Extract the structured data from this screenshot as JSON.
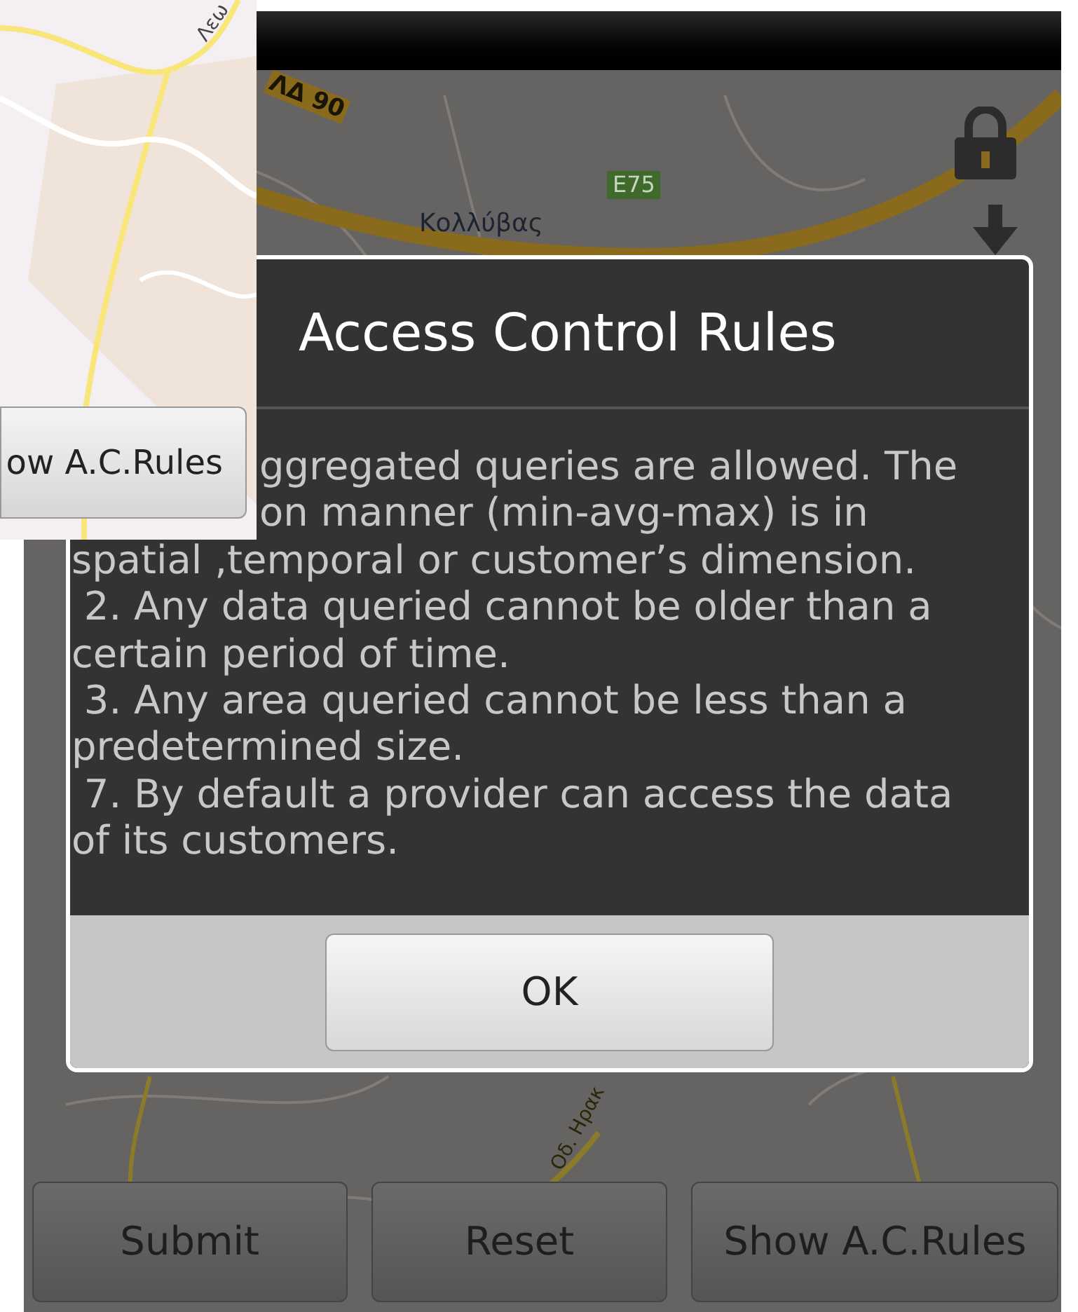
{
  "inset": {
    "map_label": "Λεω",
    "button": "ow A.C.Rules"
  },
  "map": {
    "labels": [
      {
        "kind": "road",
        "text": "ΛΔ 90"
      },
      {
        "kind": "shield",
        "text": "E75"
      },
      {
        "kind": "place",
        "text": "Κολλύβας"
      },
      {
        "kind": "street",
        "text": "Οδ. Ηρακ"
      }
    ]
  },
  "dialog": {
    "title": "Access Control Rules",
    "lines": [
      {
        "kind": "partial",
        "text": "ggregated queries are allowed. The"
      },
      {
        "kind": "partial",
        "text": "on manner (min-avg-max) is in"
      },
      {
        "kind": "full",
        "text": "spatial ,temporal or customer’s dimension."
      },
      {
        "kind": "full",
        "text": " 2. Any data queried cannot be older than a"
      },
      {
        "kind": "full",
        "text": "certain period of time."
      },
      {
        "kind": "full",
        "text": " 3. Any area queried cannot be less than a"
      },
      {
        "kind": "full",
        "text": "predetermined size."
      },
      {
        "kind": "full",
        "text": " 7. By default a provider can access the data"
      },
      {
        "kind": "full",
        "text": "of its customers."
      }
    ],
    "button": "OK"
  },
  "buttons": [
    "Submit",
    "Reset",
    "Show A.C.Rules"
  ]
}
